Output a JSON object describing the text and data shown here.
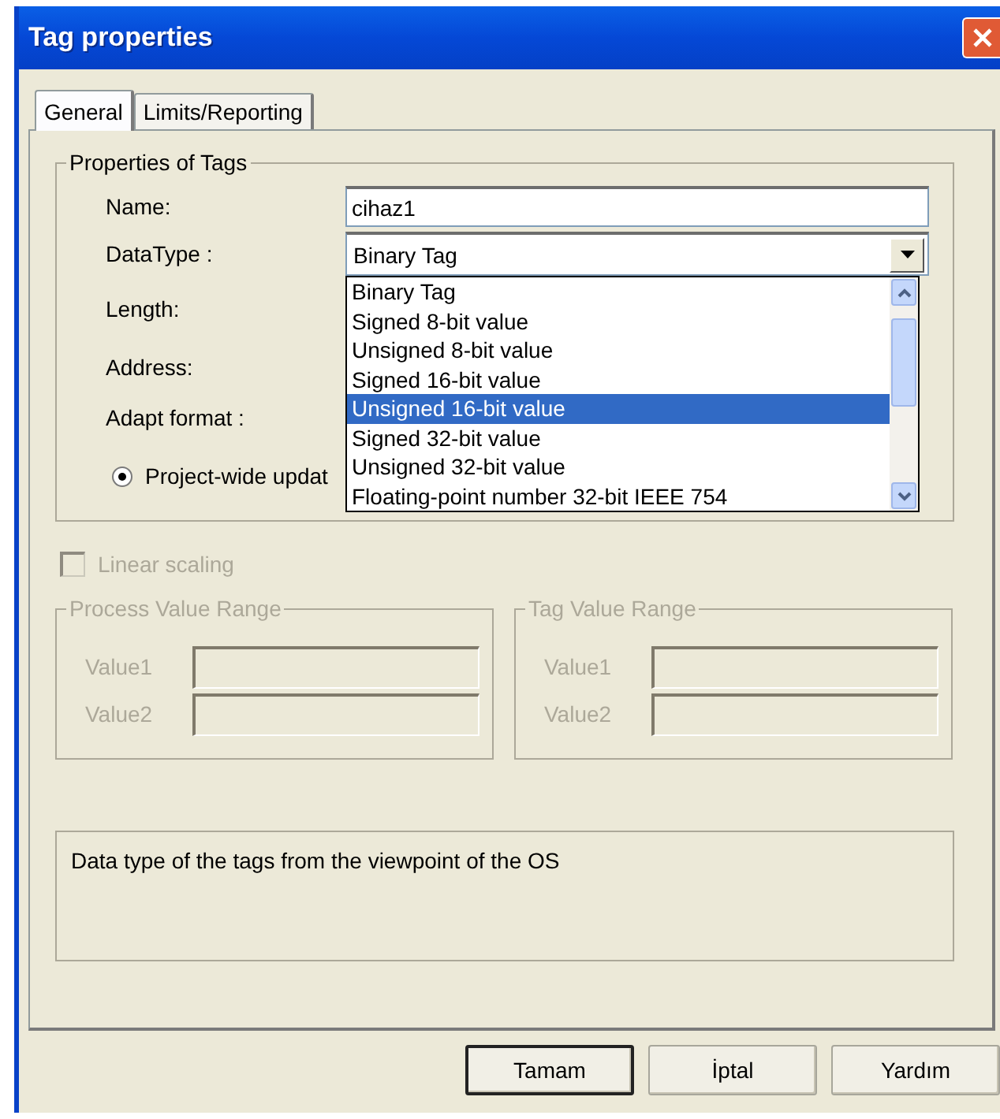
{
  "window": {
    "title": "Tag properties"
  },
  "tabs": [
    {
      "label": "General",
      "selected": true
    },
    {
      "label": "Limits/Reporting",
      "selected": false
    }
  ],
  "properties": {
    "title": "Properties of Tags",
    "name": {
      "label": "Name:",
      "value": "cihaz1"
    },
    "data_type": {
      "label": "DataType :",
      "value": "Binary Tag",
      "expanded": true,
      "options": [
        {
          "label": "Binary Tag",
          "highlighted": false
        },
        {
          "label": "Signed 8-bit value",
          "highlighted": false
        },
        {
          "label": "Unsigned 8-bit value",
          "highlighted": false
        },
        {
          "label": "Signed 16-bit value",
          "highlighted": false
        },
        {
          "label": "Unsigned 16-bit value",
          "highlighted": true
        },
        {
          "label": "Signed 32-bit value",
          "highlighted": false
        },
        {
          "label": "Unsigned 32-bit value",
          "highlighted": false
        },
        {
          "label": "Floating-point number 32-bit IEEE 754",
          "highlighted": false
        }
      ]
    },
    "labels": [
      "Length:",
      "Address:",
      "Adapt format :"
    ],
    "update_radio": {
      "label": "Project-wide updat",
      "selected": true
    }
  },
  "scaling": {
    "label": "Linear scaling",
    "checked": false,
    "disabled": true,
    "ranges": [
      {
        "title": "Process Value Range",
        "fields": [
          "Value1",
          "Value2"
        ]
      },
      {
        "title": "Tag Value Range",
        "fields": [
          "Value1",
          "Value2"
        ]
      }
    ]
  },
  "description": "Data type of the tags from the viewpoint of the OS",
  "buttons": [
    {
      "label": "Tamam",
      "default": true
    },
    {
      "label": "İptal",
      "default": false
    },
    {
      "label": "Yardım",
      "default": false
    }
  ]
}
